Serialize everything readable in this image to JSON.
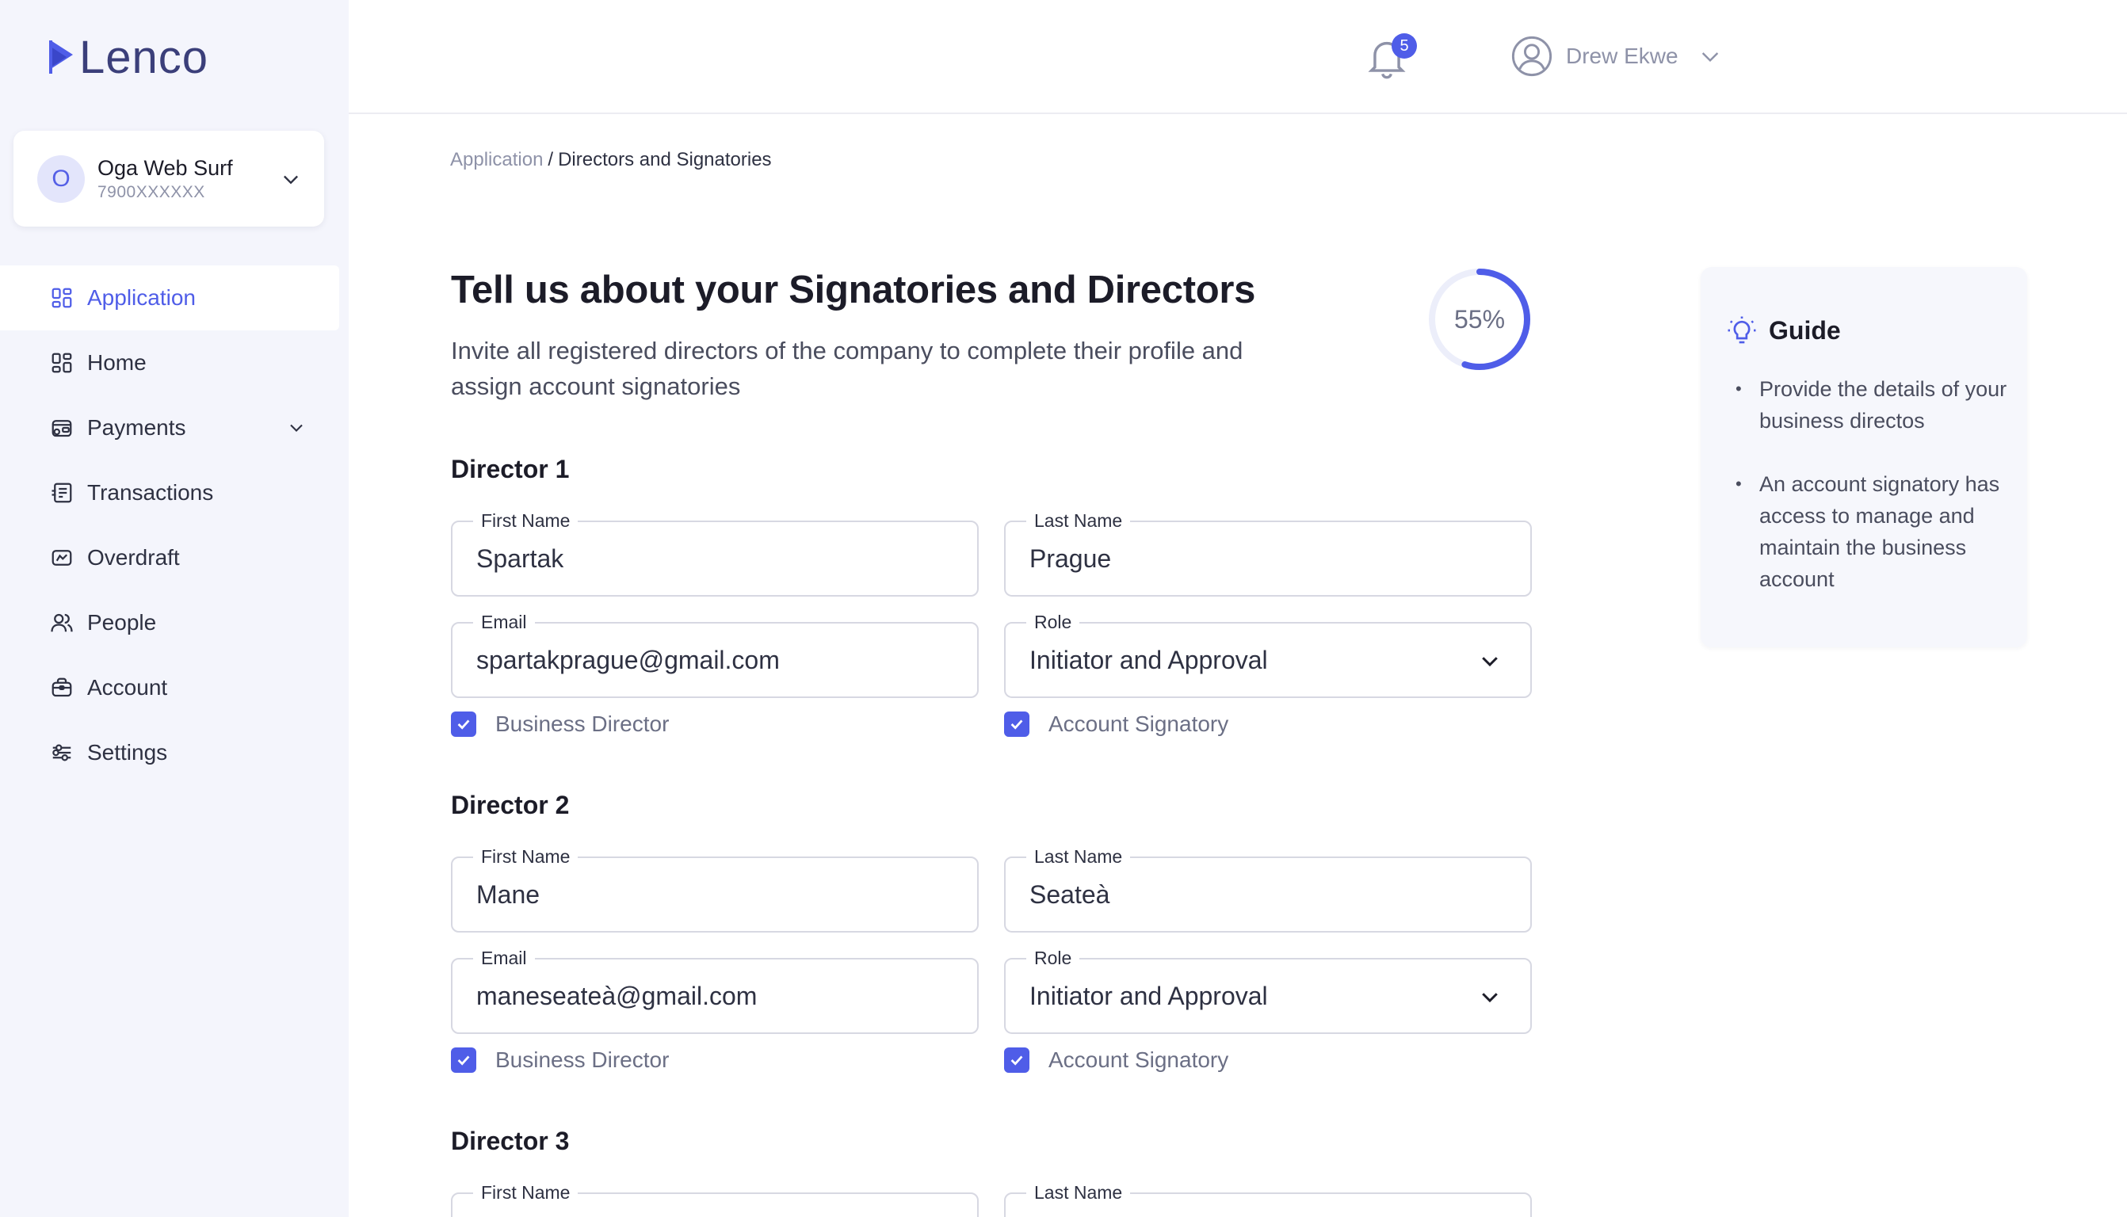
{
  "brand": {
    "name": "Lenco",
    "accent": "#4f5de8"
  },
  "account": {
    "initial": "O",
    "name": "Oga Web Surf",
    "number": "7900XXXXXX"
  },
  "nav": {
    "items": [
      {
        "label": "Application",
        "icon": "grid-icon",
        "active": true
      },
      {
        "label": "Home",
        "icon": "grid-icon"
      },
      {
        "label": "Payments",
        "icon": "wallet-icon",
        "has_submenu": true
      },
      {
        "label": "Transactions",
        "icon": "receipt-icon"
      },
      {
        "label": "Overdraft",
        "icon": "card-icon"
      },
      {
        "label": "People",
        "icon": "people-icon"
      },
      {
        "label": "Account",
        "icon": "briefcase-icon"
      },
      {
        "label": "Settings",
        "icon": "sliders-icon"
      }
    ]
  },
  "header": {
    "notification_count": "5",
    "user_name": "Drew Ekwe"
  },
  "breadcrumb": {
    "parent": "Application",
    "separator": "/",
    "current": "Directors and Signatories"
  },
  "page": {
    "title": "Tell us about your Signatories and Directors",
    "subtitle": "Invite all registered directors of the company to complete their profile and assign account signatories",
    "progress": 55,
    "progress_label": "55%"
  },
  "directors": [
    {
      "heading": "Director 1",
      "first_name_label": "First Name",
      "first_name": "Spartak",
      "last_name_label": "Last Name",
      "last_name": "Prague",
      "email_label": "Email",
      "email": "spartakprague@gmail.com",
      "role_label": "Role",
      "role": "Initiator and Approval",
      "business_director_label": "Business Director",
      "business_director": true,
      "account_signatory_label": "Account Signatory",
      "account_signatory": true
    },
    {
      "heading": "Director 2",
      "first_name_label": "First Name",
      "first_name": "Mane",
      "last_name_label": "Last Name",
      "last_name": "Seateà",
      "email_label": "Email",
      "email": "maneseateà@gmail.com",
      "role_label": "Role",
      "role": "Initiator and Approval",
      "business_director_label": "Business Director",
      "business_director": true,
      "account_signatory_label": "Account Signatory",
      "account_signatory": true
    },
    {
      "heading": "Director 3",
      "first_name_label": "First Name",
      "first_name": "",
      "last_name_label": "Last Name",
      "last_name": ""
    }
  ],
  "guide": {
    "title": "Guide",
    "items": [
      "Provide the details of your business directos",
      "An account signatory has access to manage and maintain the business account"
    ]
  }
}
